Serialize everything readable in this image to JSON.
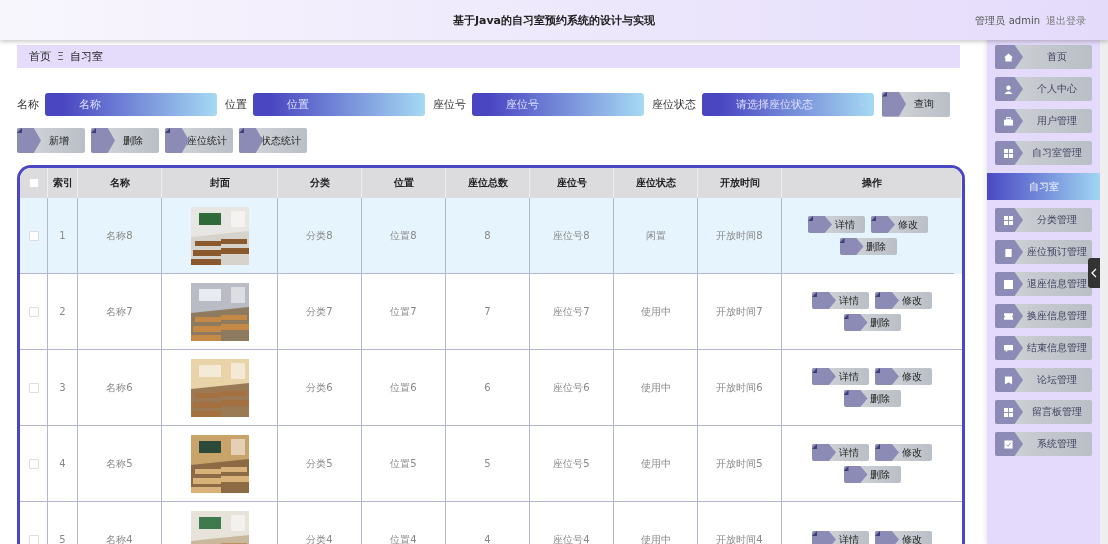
{
  "header": {
    "title": "基于Java的自习室预约系统的设计与实现",
    "user": "管理员 admin",
    "logout": "退出登录"
  },
  "breadcrumb": [
    "首页",
    "自习室"
  ],
  "breadcrumb_separator": "Ξ",
  "search": [
    {
      "label": "名称",
      "placeholder": "名称",
      "kind": "input"
    },
    {
      "label": "位置",
      "placeholder": "位置",
      "kind": "input"
    },
    {
      "label": "座位号",
      "placeholder": "座位号",
      "kind": "input"
    },
    {
      "label": "座位状态",
      "placeholder": "请选择座位状态",
      "kind": "select"
    }
  ],
  "search_button": "查询",
  "toolbar": [
    "新增",
    "删除",
    "座位统计",
    "状态统计"
  ],
  "table": {
    "columns": [
      "索引",
      "名称",
      "封面",
      "分类",
      "位置",
      "座位总数",
      "座位号",
      "座位状态",
      "开放时间",
      "操作"
    ],
    "select_all_checked": false,
    "rows": [
      {
        "selected": true,
        "checked": false,
        "cells": [
          "1",
          "名称8",
          "",
          "分类8",
          "位置8",
          "8",
          "座位号8",
          "闲置",
          "开放时间8"
        ],
        "actions": [
          "详情",
          "修改",
          "删除"
        ]
      },
      {
        "selected": false,
        "checked": false,
        "cells": [
          "2",
          "名称7",
          "",
          "分类7",
          "位置7",
          "7",
          "座位号7",
          "使用中",
          "开放时间7"
        ],
        "actions": [
          "详情",
          "修改",
          "删除"
        ]
      },
      {
        "selected": false,
        "checked": false,
        "cells": [
          "3",
          "名称6",
          "",
          "分类6",
          "位置6",
          "6",
          "座位号6",
          "使用中",
          "开放时间6"
        ],
        "actions": [
          "详情",
          "修改",
          "删除"
        ]
      },
      {
        "selected": false,
        "checked": false,
        "cells": [
          "4",
          "名称5",
          "",
          "分类5",
          "位置5",
          "5",
          "座位号5",
          "使用中",
          "开放时间5"
        ],
        "actions": [
          "详情",
          "修改",
          "删除"
        ]
      },
      {
        "selected": false,
        "checked": false,
        "cells": [
          "5",
          "名称4",
          "",
          "分类4",
          "位置4",
          "4",
          "座位号4",
          "使用中",
          "开放时间4"
        ],
        "actions": [
          "详情",
          "修改"
        ]
      }
    ]
  },
  "sidebar": {
    "items": [
      {
        "label": "首页",
        "selected": false
      },
      {
        "label": "个人中心",
        "selected": false
      },
      {
        "label": "用户管理",
        "selected": false
      },
      {
        "label": "自习室管理",
        "selected": false
      },
      {
        "label": "自习室",
        "selected": true
      },
      {
        "label": "分类管理",
        "selected": false
      },
      {
        "label": "座位预订管理",
        "selected": false
      },
      {
        "label": "退座信息管理",
        "selected": false
      },
      {
        "label": "换座信息管理",
        "selected": false
      },
      {
        "label": "结束信息管理",
        "selected": false
      },
      {
        "label": "论坛管理",
        "selected": false
      },
      {
        "label": "留言板管理",
        "selected": false
      },
      {
        "label": "系统管理",
        "selected": false
      }
    ]
  }
}
